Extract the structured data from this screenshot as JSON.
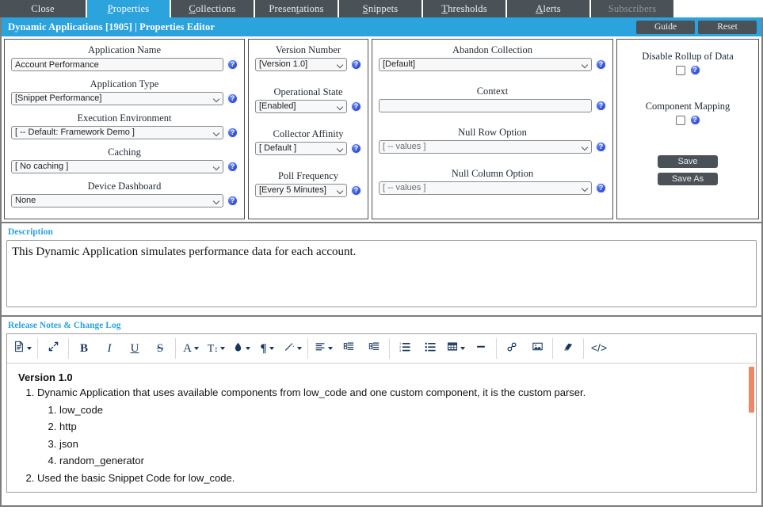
{
  "tabs": [
    {
      "label": "Close",
      "accel": "",
      "active": false,
      "disabled": false,
      "name": "tab-close"
    },
    {
      "label": "Properties",
      "accel": "P",
      "active": true,
      "disabled": false,
      "name": "tab-properties"
    },
    {
      "label": "Collections",
      "accel": "C",
      "active": false,
      "disabled": false,
      "name": "tab-collections"
    },
    {
      "label": "Presentations",
      "accel": "t",
      "active": false,
      "disabled": false,
      "name": "tab-presentations"
    },
    {
      "label": "Snippets",
      "accel": "S",
      "active": false,
      "disabled": false,
      "name": "tab-snippets"
    },
    {
      "label": "Thresholds",
      "accel": "T",
      "active": false,
      "disabled": false,
      "name": "tab-thresholds"
    },
    {
      "label": "Alerts",
      "accel": "A",
      "active": false,
      "disabled": false,
      "name": "tab-alerts"
    },
    {
      "label": "Subscribers",
      "accel": "",
      "active": false,
      "disabled": true,
      "name": "tab-subscribers"
    }
  ],
  "header": {
    "title": "Dynamic Applications [1905] | Properties Editor",
    "guide_label": "Guide",
    "reset_label": "Reset",
    "accent_color": "#2ba3dd",
    "button_color": "#4b5257"
  },
  "form": {
    "column1": [
      {
        "label": "Application Name",
        "type": "text",
        "value": "Account Performance",
        "name": "application-name"
      },
      {
        "label": "Application Type",
        "type": "select",
        "value": "[Snippet Performance]",
        "name": "application-type"
      },
      {
        "label": "Execution Environment",
        "type": "select",
        "value": "[ -- Default: Framework Demo ]",
        "name": "execution-environment"
      },
      {
        "label": "Caching",
        "type": "select",
        "value": "[ No caching ]",
        "name": "caching"
      },
      {
        "label": "Device Dashboard",
        "type": "select",
        "value": "None",
        "name": "device-dashboard"
      }
    ],
    "column2": [
      {
        "label": "Version Number",
        "type": "select",
        "value": "[Version 1.0]",
        "name": "version-number"
      },
      {
        "label": "Operational State",
        "type": "select",
        "value": "[Enabled]",
        "name": "operational-state"
      },
      {
        "label": "Collector Affinity",
        "type": "select",
        "value": "[ Default ]",
        "name": "collector-affinity"
      },
      {
        "label": "Poll Frequency",
        "type": "select",
        "value": "[Every 5 Minutes]",
        "name": "poll-frequency"
      }
    ],
    "column3": [
      {
        "label": "Abandon Collection",
        "type": "select",
        "value": "[Default]",
        "name": "abandon-collection",
        "muted": false
      },
      {
        "label": "Context",
        "type": "text",
        "value": "",
        "name": "context",
        "muted": false
      },
      {
        "label": "Null Row Option",
        "type": "select",
        "value": "[ -- values ]",
        "name": "null-row-option",
        "muted": true
      },
      {
        "label": "Null Column Option",
        "type": "select",
        "value": "[ -- values ]",
        "name": "null-column-option",
        "muted": true
      }
    ],
    "column4": {
      "disable_rollup_label": "Disable Rollup of Data",
      "disable_rollup_checked": false,
      "component_mapping_label": "Component Mapping",
      "component_mapping_checked": false,
      "save_label": "Save",
      "save_as_label": "Save As"
    },
    "help_glyph": "?"
  },
  "description": {
    "section_title": "Description",
    "value": "This Dynamic Application simulates performance data for each account.",
    "placeholder": ""
  },
  "release_notes": {
    "section_title": "Release Notes & Change Log",
    "toolbar_groups": [
      [
        {
          "icon": "document-icon",
          "glyph": "὜E",
          "label": "document",
          "dropdown": true,
          "name": "tool-document"
        }
      ],
      [
        {
          "icon": "expand-arrows-icon",
          "glyph": "⤡",
          "label": "fullscreen",
          "dropdown": false,
          "name": "tool-fullscreen"
        }
      ],
      [
        {
          "icon": "bold-icon",
          "glyph": "B",
          "label": "Bold",
          "dropdown": false,
          "name": "tool-bold"
        },
        {
          "icon": "italic-icon",
          "glyph": "I",
          "label": "Italic",
          "dropdown": false,
          "name": "tool-italic"
        },
        {
          "icon": "underline-icon",
          "glyph": "U",
          "label": "Underline",
          "dropdown": false,
          "name": "tool-underline"
        },
        {
          "icon": "strikethrough-icon",
          "glyph": "S",
          "label": "Strikethrough",
          "dropdown": false,
          "name": "tool-strikethrough"
        }
      ],
      [
        {
          "icon": "font-family-icon",
          "glyph": "A",
          "label": "Font",
          "dropdown": true,
          "name": "tool-font-family"
        },
        {
          "icon": "font-size-icon",
          "glyph": "TI",
          "label": "Font size",
          "dropdown": true,
          "name": "tool-font-size"
        },
        {
          "icon": "text-color-icon",
          "glyph": "◆",
          "label": "Text color",
          "dropdown": true,
          "name": "tool-text-color"
        },
        {
          "icon": "paragraph-icon",
          "glyph": "¶",
          "label": "Paragraph",
          "dropdown": true,
          "name": "tool-paragraph"
        },
        {
          "icon": "magic-wand-icon",
          "glyph": "✒",
          "label": "Styles",
          "dropdown": true,
          "name": "tool-styles"
        }
      ],
      [
        {
          "icon": "align-left-icon",
          "glyph": "≡",
          "label": "Align",
          "dropdown": true,
          "name": "tool-align"
        },
        {
          "icon": "outdent-icon",
          "glyph": "⤒",
          "label": "Decrease indent",
          "dropdown": false,
          "name": "tool-outdent"
        },
        {
          "icon": "indent-icon",
          "glyph": "⤓",
          "label": "Increase indent",
          "dropdown": false,
          "name": "tool-indent"
        }
      ],
      [
        {
          "icon": "ordered-list-icon",
          "glyph": "≣",
          "label": "Numbered list",
          "dropdown": false,
          "name": "tool-ordered-list"
        },
        {
          "icon": "unordered-list-icon",
          "glyph": "≣",
          "label": "Bulleted list",
          "dropdown": false,
          "name": "tool-unordered-list"
        },
        {
          "icon": "table-icon",
          "glyph": "▦",
          "label": "Table",
          "dropdown": true,
          "name": "tool-table"
        },
        {
          "icon": "horizontal-rule-icon",
          "glyph": "▂",
          "label": "Horizontal rule",
          "dropdown": false,
          "name": "tool-horizontal-rule"
        }
      ],
      [
        {
          "icon": "link-icon",
          "glyph": "⚭",
          "label": "Link",
          "dropdown": false,
          "name": "tool-link"
        },
        {
          "icon": "image-icon",
          "glyph": "ὛB",
          "label": "Image",
          "dropdown": false,
          "name": "tool-image"
        }
      ],
      [
        {
          "icon": "eraser-icon",
          "glyph": "▱",
          "label": "Clear formatting",
          "dropdown": false,
          "name": "tool-eraser"
        }
      ],
      [
        {
          "icon": "code-icon",
          "glyph": "</>",
          "label": "Source code",
          "dropdown": false,
          "name": "tool-source-code"
        }
      ]
    ],
    "content": {
      "heading": "Version 1.0",
      "items": [
        {
          "text": "Dynamic Application that uses available components from low_code and one custom component, it is the custom parser.",
          "subitems": [
            "low_code",
            "http",
            "json",
            "random_generator"
          ]
        },
        {
          "text": "Used the basic Snippet Code for low_code.",
          "subitems": []
        }
      ]
    },
    "scrollbar_color": "#ed8767"
  }
}
